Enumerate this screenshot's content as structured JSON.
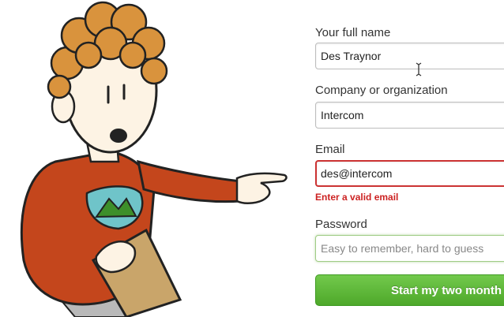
{
  "form": {
    "full_name": {
      "label": "Your full name",
      "value": "Des Traynor"
    },
    "company": {
      "label": "Company or organization",
      "value": "Intercom"
    },
    "email": {
      "label": "Email",
      "value": "des@intercom",
      "error": "Enter a valid email"
    },
    "password": {
      "label": "Password",
      "placeholder": "Easy to remember, hard to guess"
    },
    "submit_label": "Start my two month"
  },
  "colors": {
    "error": "#cc2222",
    "button_green": "#5cb535",
    "sweater": "#c4461c",
    "hair": "#d9933d"
  },
  "icons": [
    "text-cursor-icon",
    "mountain-badge-icon"
  ]
}
